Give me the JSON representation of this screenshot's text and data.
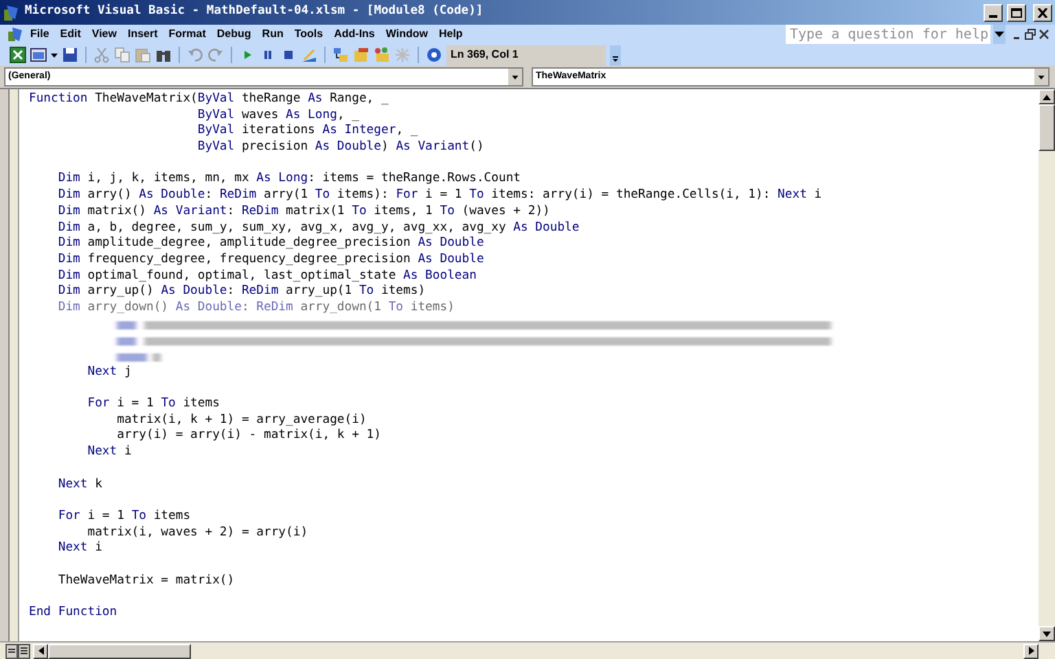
{
  "window": {
    "title": "Microsoft Visual Basic - MathDefault-04.xlsm - [Module8 (Code)]"
  },
  "menu": [
    {
      "label": "File"
    },
    {
      "label": "Edit"
    },
    {
      "label": "View"
    },
    {
      "label": "Insert"
    },
    {
      "label": "Format"
    },
    {
      "label": "Debug"
    },
    {
      "label": "Run"
    },
    {
      "label": "Tools"
    },
    {
      "label": "Add-Ins"
    },
    {
      "label": "Window"
    },
    {
      "label": "Help"
    }
  ],
  "help_box": {
    "placeholder": "Type a question for help"
  },
  "toolbar": {
    "position": "Ln 369, Col 1"
  },
  "object_box": {
    "value": "(General)"
  },
  "procedure_box": {
    "value": "TheWaveMatrix"
  },
  "code_lines": [
    {
      "kind": "code",
      "segments": [
        {
          "text": "Function",
          "kind": "keyword"
        },
        {
          "text": " TheWaveMatrix(",
          "kind": "plain"
        },
        {
          "text": "ByVal",
          "kind": "keyword"
        },
        {
          "text": " theRange ",
          "kind": "plain"
        },
        {
          "text": "As",
          "kind": "keyword"
        },
        {
          "text": " Range, _",
          "kind": "plain"
        }
      ]
    },
    {
      "kind": "code",
      "segments": [
        {
          "text": "                       ByVal",
          "kind": "keyword"
        },
        {
          "text": " waves ",
          "kind": "plain"
        },
        {
          "text": "As Long",
          "kind": "keyword"
        },
        {
          "text": ", _",
          "kind": "plain"
        }
      ]
    },
    {
      "kind": "code",
      "segments": [
        {
          "text": "                       ByVal",
          "kind": "keyword"
        },
        {
          "text": " iterations ",
          "kind": "plain"
        },
        {
          "text": "As Integer",
          "kind": "keyword"
        },
        {
          "text": ", _",
          "kind": "plain"
        }
      ]
    },
    {
      "kind": "code",
      "segments": [
        {
          "text": "                       ByVal",
          "kind": "keyword"
        },
        {
          "text": " precision ",
          "kind": "plain"
        },
        {
          "text": "As Double",
          "kind": "keyword"
        },
        {
          "text": ") ",
          "kind": "plain"
        },
        {
          "text": "As Variant",
          "kind": "keyword"
        },
        {
          "text": "()",
          "kind": "plain"
        }
      ]
    },
    {
      "kind": "blank"
    },
    {
      "kind": "code",
      "segments": [
        {
          "text": "    Dim",
          "kind": "keyword"
        },
        {
          "text": " i, j, k, items, mn, mx ",
          "kind": "plain"
        },
        {
          "text": "As Long",
          "kind": "keyword"
        },
        {
          "text": ": items = theRange.Rows.Count",
          "kind": "plain"
        }
      ]
    },
    {
      "kind": "code",
      "segments": [
        {
          "text": "    Dim",
          "kind": "keyword"
        },
        {
          "text": " arry() ",
          "kind": "plain"
        },
        {
          "text": "As Double",
          "kind": "keyword"
        },
        {
          "text": ": ",
          "kind": "plain"
        },
        {
          "text": "ReDim",
          "kind": "keyword"
        },
        {
          "text": " arry(1 ",
          "kind": "plain"
        },
        {
          "text": "To",
          "kind": "keyword"
        },
        {
          "text": " items): ",
          "kind": "plain"
        },
        {
          "text": "For",
          "kind": "keyword"
        },
        {
          "text": " i = 1 ",
          "kind": "plain"
        },
        {
          "text": "To",
          "kind": "keyword"
        },
        {
          "text": " items: arry(i) = theRange.Cells(i, 1): ",
          "kind": "plain"
        },
        {
          "text": "Next",
          "kind": "keyword"
        },
        {
          "text": " i",
          "kind": "plain"
        }
      ]
    },
    {
      "kind": "code",
      "segments": [
        {
          "text": "    Dim",
          "kind": "keyword"
        },
        {
          "text": " matrix() ",
          "kind": "plain"
        },
        {
          "text": "As Variant",
          "kind": "keyword"
        },
        {
          "text": ": ",
          "kind": "plain"
        },
        {
          "text": "ReDim",
          "kind": "keyword"
        },
        {
          "text": " matrix(1 ",
          "kind": "plain"
        },
        {
          "text": "To",
          "kind": "keyword"
        },
        {
          "text": " items, 1 ",
          "kind": "plain"
        },
        {
          "text": "To",
          "kind": "keyword"
        },
        {
          "text": " (waves + 2))",
          "kind": "plain"
        }
      ]
    },
    {
      "kind": "code",
      "segments": [
        {
          "text": "    Dim",
          "kind": "keyword"
        },
        {
          "text": " a, b, degree, sum_y, sum_xy, avg_x, avg_y, avg_xx, avg_xy ",
          "kind": "plain"
        },
        {
          "text": "As Double",
          "kind": "keyword"
        }
      ]
    },
    {
      "kind": "code",
      "segments": [
        {
          "text": "    Dim",
          "kind": "keyword"
        },
        {
          "text": " amplitude_degree, amplitude_degree_precision ",
          "kind": "plain"
        },
        {
          "text": "As Double",
          "kind": "keyword"
        }
      ]
    },
    {
      "kind": "code",
      "segments": [
        {
          "text": "    Dim",
          "kind": "keyword"
        },
        {
          "text": " frequency_degree, frequency_degree_precision ",
          "kind": "plain"
        },
        {
          "text": "As Double",
          "kind": "keyword"
        }
      ]
    },
    {
      "kind": "code",
      "segments": [
        {
          "text": "    Dim",
          "kind": "keyword"
        },
        {
          "text": " optimal_found, optimal, last_optimal_state ",
          "kind": "plain"
        },
        {
          "text": "As Boolean",
          "kind": "keyword"
        }
      ]
    },
    {
      "kind": "code",
      "segments": [
        {
          "text": "    Dim",
          "kind": "keyword"
        },
        {
          "text": " arry_up() ",
          "kind": "plain"
        },
        {
          "text": "As Double",
          "kind": "keyword"
        },
        {
          "text": ": ",
          "kind": "plain"
        },
        {
          "text": "ReDim",
          "kind": "keyword"
        },
        {
          "text": " arry_up(1 ",
          "kind": "plain"
        },
        {
          "text": "To",
          "kind": "keyword"
        },
        {
          "text": " items)",
          "kind": "plain"
        }
      ]
    },
    {
      "kind": "faded",
      "segments": [
        {
          "text": "    Dim",
          "kind": "keyword"
        },
        {
          "text": " arry_down() ",
          "kind": "plain"
        },
        {
          "text": "As Double",
          "kind": "keyword"
        },
        {
          "text": ": ",
          "kind": "plain"
        },
        {
          "text": "ReDim",
          "kind": "keyword"
        },
        {
          "text": " arry_down(1 ",
          "kind": "plain"
        },
        {
          "text": "To",
          "kind": "keyword"
        },
        {
          "text": " items)",
          "kind": "plain"
        }
      ]
    },
    {
      "kind": "blurred"
    },
    {
      "kind": "blurred"
    },
    {
      "kind": "blurred"
    },
    {
      "kind": "code",
      "segments": [
        {
          "text": "        Next",
          "kind": "keyword"
        },
        {
          "text": " j",
          "kind": "plain"
        }
      ]
    },
    {
      "kind": "blank"
    },
    {
      "kind": "code",
      "segments": [
        {
          "text": "        For",
          "kind": "keyword"
        },
        {
          "text": " i = 1 ",
          "kind": "plain"
        },
        {
          "text": "To",
          "kind": "keyword"
        },
        {
          "text": " items",
          "kind": "plain"
        }
      ]
    },
    {
      "kind": "code",
      "segments": [
        {
          "text": "            matrix(i, k + 1) = arry_average(i)",
          "kind": "plain"
        }
      ]
    },
    {
      "kind": "code",
      "segments": [
        {
          "text": "            arry(i) = arry(i) - matrix(i, k + 1)",
          "kind": "plain"
        }
      ]
    },
    {
      "kind": "code",
      "segments": [
        {
          "text": "        Next",
          "kind": "keyword"
        },
        {
          "text": " i",
          "kind": "plain"
        }
      ]
    },
    {
      "kind": "blank"
    },
    {
      "kind": "code",
      "segments": [
        {
          "text": "    Next",
          "kind": "keyword"
        },
        {
          "text": " k",
          "kind": "plain"
        }
      ]
    },
    {
      "kind": "blank"
    },
    {
      "kind": "code",
      "segments": [
        {
          "text": "    For",
          "kind": "keyword"
        },
        {
          "text": " i = 1 ",
          "kind": "plain"
        },
        {
          "text": "To",
          "kind": "keyword"
        },
        {
          "text": " items",
          "kind": "plain"
        }
      ]
    },
    {
      "kind": "code",
      "segments": [
        {
          "text": "        matrix(i, waves + 2) = arry(i)",
          "kind": "plain"
        }
      ]
    },
    {
      "kind": "code",
      "segments": [
        {
          "text": "    Next",
          "kind": "keyword"
        },
        {
          "text": " i",
          "kind": "plain"
        }
      ]
    },
    {
      "kind": "blank"
    },
    {
      "kind": "code",
      "segments": [
        {
          "text": "    TheWaveMatrix = matrix()",
          "kind": "plain"
        }
      ]
    },
    {
      "kind": "blank"
    },
    {
      "kind": "code",
      "segments": [
        {
          "text": "End Function",
          "kind": "keyword"
        }
      ]
    }
  ]
}
